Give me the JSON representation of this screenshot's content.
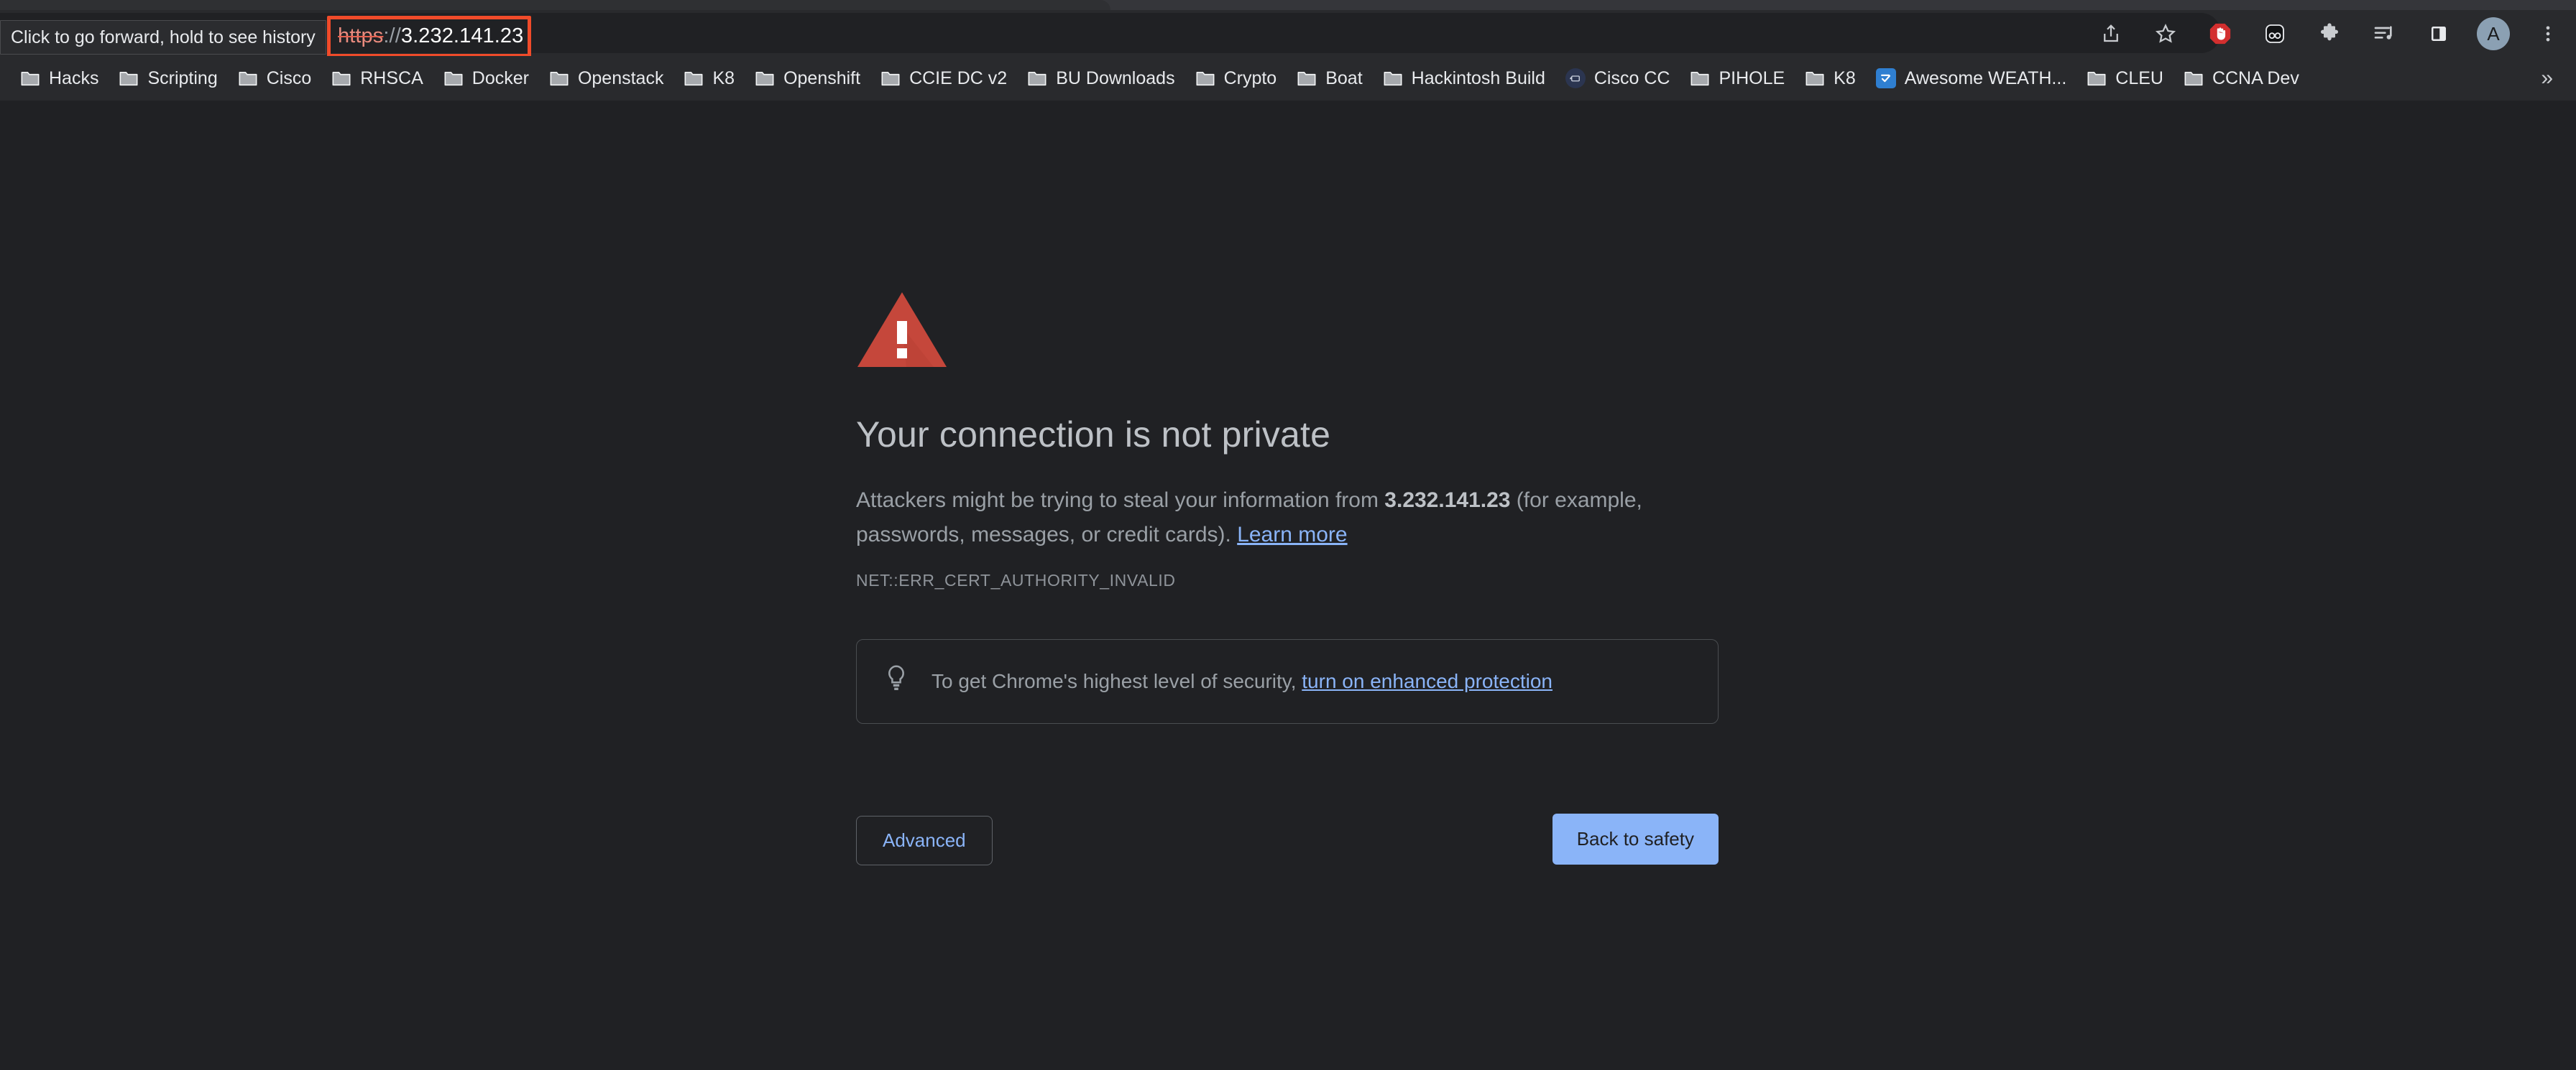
{
  "browser": {
    "tooltip": "Click to go forward, hold to see history",
    "omnibox": {
      "scheme": "https",
      "separator": "://",
      "host": "3.232.141.23",
      "annotation_color": "#f04b2a"
    },
    "nav_icons": [
      "back-icon",
      "forward-icon",
      "reload-icon"
    ],
    "actions": [
      {
        "name": "share-icon",
        "label": "Share"
      },
      {
        "name": "bookmark-star-icon",
        "label": "Bookmark this tab"
      },
      {
        "name": "adblock-icon",
        "label": "AdBlock"
      },
      {
        "name": "extension-dark-icon",
        "label": "Extension"
      },
      {
        "name": "puzzle-icon",
        "label": "Extensions"
      },
      {
        "name": "music-playlist-icon",
        "label": "Media"
      },
      {
        "name": "side-panel-icon",
        "label": "Side panel"
      },
      {
        "name": "profile-avatar",
        "label": "A"
      },
      {
        "name": "chrome-menu-icon",
        "label": "Customize and control Google Chrome"
      }
    ],
    "bookmarks": {
      "items": [
        {
          "label": "Hacks",
          "icon": "folder"
        },
        {
          "label": "Scripting",
          "icon": "folder"
        },
        {
          "label": "Cisco",
          "icon": "folder"
        },
        {
          "label": "RHSCA",
          "icon": "folder"
        },
        {
          "label": "Docker",
          "icon": "folder"
        },
        {
          "label": "Openstack",
          "icon": "folder"
        },
        {
          "label": "K8",
          "icon": "folder"
        },
        {
          "label": "Openshift",
          "icon": "folder"
        },
        {
          "label": "CCIE DC v2",
          "icon": "folder"
        },
        {
          "label": "BU Downloads",
          "icon": "folder"
        },
        {
          "label": "Crypto",
          "icon": "folder"
        },
        {
          "label": "Boat",
          "icon": "folder"
        },
        {
          "label": "Hackintosh Build",
          "icon": "folder"
        },
        {
          "label": "Cisco CC",
          "icon": "cisco-favicon"
        },
        {
          "label": "PIHOLE",
          "icon": "folder"
        },
        {
          "label": "K8",
          "icon": "folder"
        },
        {
          "label": "Awesome WEATH...",
          "icon": "weather-favicon"
        },
        {
          "label": "CLEU",
          "icon": "folder"
        },
        {
          "label": "CCNA Dev",
          "icon": "folder"
        }
      ],
      "overflow_label": "»"
    }
  },
  "interstitial": {
    "icon": "warning-triangle-icon",
    "headline": "Your connection is not private",
    "body_prefix": "Attackers might be trying to steal your information from ",
    "body_host": "3.232.141.23",
    "body_suffix": " (for example, passwords, messages, or credit cards). ",
    "learn_more": "Learn more",
    "error_code": "NET::ERR_CERT_AUTHORITY_INVALID",
    "callout": {
      "icon": "lightbulb-icon",
      "text": "To get Chrome's highest level of security, ",
      "link": "turn on enhanced protection"
    },
    "advanced_label": "Advanced",
    "back_to_safety_label": "Back to safety",
    "colors": {
      "warning_red": "#c5473b",
      "link_blue": "#8ab4f8",
      "page_background": "#202124"
    }
  }
}
